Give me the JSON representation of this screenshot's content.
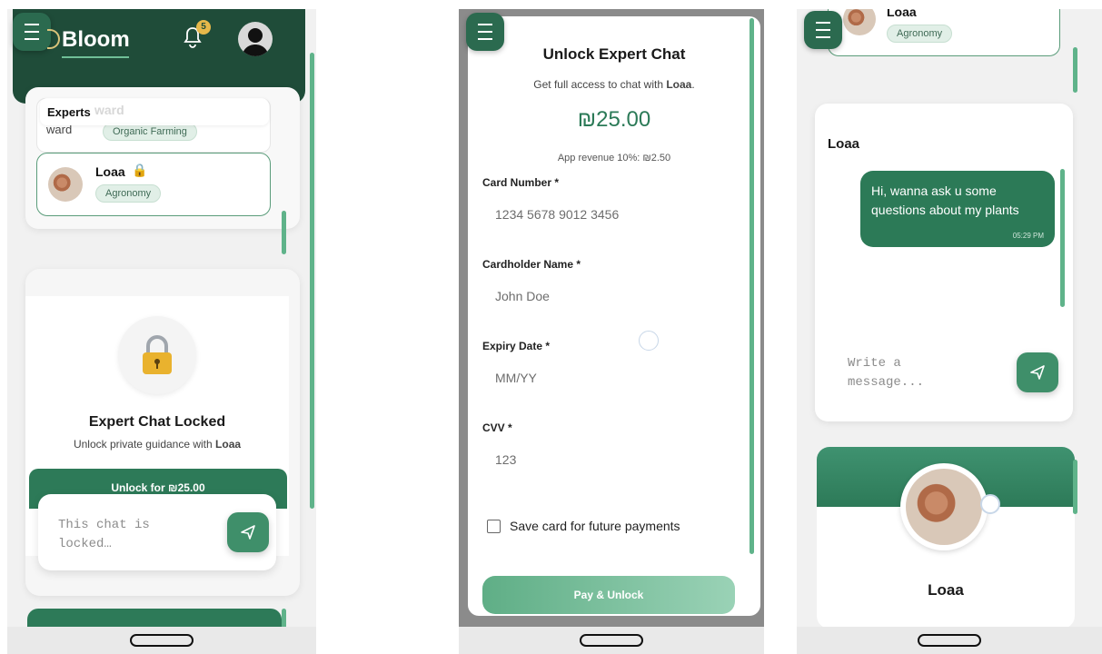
{
  "screen1": {
    "app_title": "Bloom",
    "notification_count": "5",
    "experts_label": "Experts",
    "faded_name": "ward",
    "faded_name_row": "ward",
    "faded_specialty": "Organic Farming",
    "expert_name": "Loaa",
    "expert_specialty": "Agronomy",
    "locked_title": "Expert Chat Locked",
    "locked_sub_prefix": "Unlock private guidance with ",
    "locked_sub_name": "Loaa",
    "unlock_button": "Unlock for ₪25.00",
    "input_placeholder": "This chat is locked…"
  },
  "screen2": {
    "title": "Unlock Expert Chat",
    "subtitle_prefix": "Get full access to chat with ",
    "subtitle_name": "Loaa",
    "subtitle_suffix": ".",
    "price": "₪25.00",
    "revenue": "App revenue 10%: ₪2.50",
    "card_number_label": "Card Number *",
    "card_number_placeholder": "1234 5678 9012 3456",
    "cardholder_label": "Cardholder Name *",
    "cardholder_placeholder": "John Doe",
    "expiry_label": "Expiry Date *",
    "expiry_placeholder": "MM/YY",
    "cvv_label": "CVV *",
    "cvv_placeholder": "123",
    "save_card_label": "Save card for future payments",
    "pay_button": "Pay & Unlock"
  },
  "screen3": {
    "top_name": "Loaa",
    "top_specialty": "Agronomy",
    "chat_header": "Loaa",
    "message_text": "Hi, wanna ask u some questions about my plants",
    "message_time": "05:29 PM",
    "input_placeholder": "Write a message...",
    "profile_name": "Loaa"
  },
  "colors": {
    "brand_dark": "#1e4d3a",
    "brand": "#2b7a57",
    "accent_light": "#6fbf97"
  }
}
